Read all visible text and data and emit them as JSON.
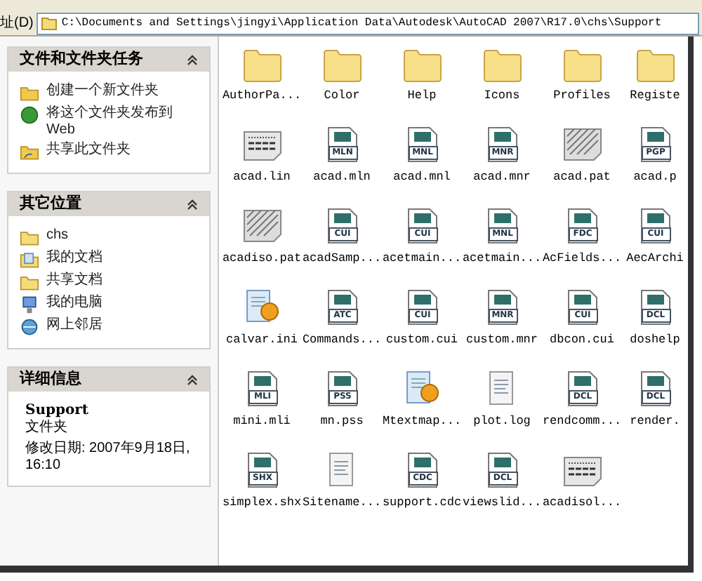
{
  "address_bar": {
    "label": "址(D)",
    "path": "C:\\Documents and Settings\\jingyi\\Application Data\\Autodesk\\AutoCAD 2007\\R17.0\\chs\\Support"
  },
  "sidebar": [
    {
      "title": "文件和文件夹任务",
      "expanded": true,
      "kind": "links",
      "items": [
        {
          "label": "创建一个新文件夹",
          "kind": "new-folder"
        },
        {
          "label": "将这个文件夹发布到",
          "sub": "Web",
          "kind": "globe"
        },
        {
          "label": "共享此文件夹",
          "kind": "share"
        }
      ]
    },
    {
      "title": "其它位置",
      "expanded": true,
      "kind": "links",
      "items": [
        {
          "label": "chs",
          "kind": "folder"
        },
        {
          "label": "我的文档",
          "kind": "docs"
        },
        {
          "label": "共享文档",
          "kind": "folder"
        },
        {
          "label": "我的电脑",
          "kind": "computer"
        },
        {
          "label": "网上邻居",
          "kind": "network"
        }
      ]
    },
    {
      "title": "详细信息",
      "expanded": true,
      "kind": "details",
      "name": "Support",
      "type": "文件夹",
      "modified": "修改日期: 2007年9月18日, 16:10"
    }
  ],
  "files": [
    {
      "name": "AuthorPa...",
      "kind": "folder"
    },
    {
      "name": "Color",
      "kind": "folder"
    },
    {
      "name": "Help",
      "kind": "folder"
    },
    {
      "name": "Icons",
      "kind": "folder"
    },
    {
      "name": "Profiles",
      "kind": "folder"
    },
    {
      "name": "Registe",
      "kind": "folder"
    },
    {
      "name": "acad.lin",
      "kind": "lines"
    },
    {
      "name": "acad.mln",
      "kind": "doc",
      "badge": "MLN"
    },
    {
      "name": "acad.mnl",
      "kind": "doc",
      "badge": "MNL"
    },
    {
      "name": "acad.mnr",
      "kind": "doc",
      "badge": "MNR"
    },
    {
      "name": "acad.pat",
      "kind": "hatch"
    },
    {
      "name": "acad.p",
      "kind": "doc",
      "badge": "PGP"
    },
    {
      "name": "acadiso.pat",
      "kind": "hatch"
    },
    {
      "name": "acadSamp...",
      "kind": "doc",
      "badge": "CUI"
    },
    {
      "name": "acetmain...",
      "kind": "doc",
      "badge": "CUI"
    },
    {
      "name": "acetmain...",
      "kind": "doc",
      "badge": "MNL"
    },
    {
      "name": "AcFields...",
      "kind": "doc",
      "badge": "FDC"
    },
    {
      "name": "AecArchi",
      "kind": "doc",
      "badge": "CUI"
    },
    {
      "name": "calvar.ini",
      "kind": "config"
    },
    {
      "name": "Commands...",
      "kind": "doc",
      "badge": "ATC"
    },
    {
      "name": "custom.cui",
      "kind": "doc",
      "badge": "CUI"
    },
    {
      "name": "custom.mnr",
      "kind": "doc",
      "badge": "MNR"
    },
    {
      "name": "dbcon.cui",
      "kind": "doc",
      "badge": "CUI"
    },
    {
      "name": "doshelp",
      "kind": "doc",
      "badge": "DCL"
    },
    {
      "name": "mini.mli",
      "kind": "doc",
      "badge": "MLI"
    },
    {
      "name": "mn.pss",
      "kind": "doc",
      "badge": "PSS"
    },
    {
      "name": "Mtextmap...",
      "kind": "config"
    },
    {
      "name": "plot.log",
      "kind": "text"
    },
    {
      "name": "rendcomm...",
      "kind": "doc",
      "badge": "DCL"
    },
    {
      "name": "render.",
      "kind": "doc",
      "badge": "DCL"
    },
    {
      "name": "simplex.shx",
      "kind": "doc",
      "badge": "SHX"
    },
    {
      "name": "Sitename...",
      "kind": "text"
    },
    {
      "name": "support.cdc",
      "kind": "doc",
      "badge": "CDC"
    },
    {
      "name": "viewslid...",
      "kind": "doc",
      "badge": "DCL"
    },
    {
      "name": "acadisol...",
      "kind": "lines"
    }
  ]
}
